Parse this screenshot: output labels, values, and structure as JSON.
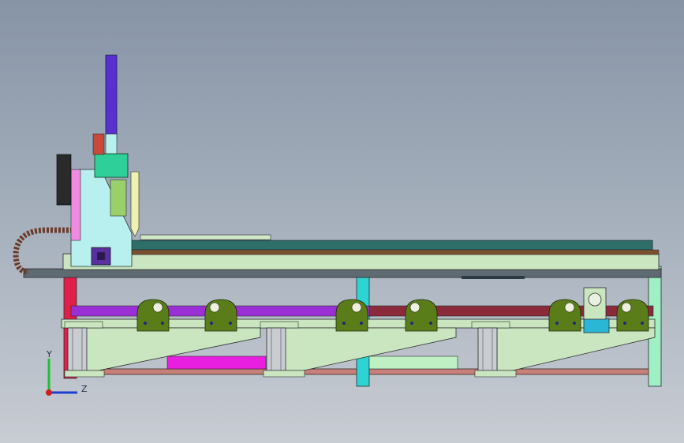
{
  "viewport": {
    "background_top": "#8794a6",
    "background_bottom": "#c8ccd3"
  },
  "triad": {
    "y_label": "Y",
    "z_label": "Z",
    "y_color": "#1fbf2f",
    "z_color": "#1d3fd1",
    "x_color": "#d11d1d"
  },
  "palette": {
    "frame": "#c9e6c0",
    "frame_stroke": "#2b2b2b",
    "gantry": "#b8f0f0",
    "mast": "#5a2fd0",
    "rail": "#2f6f6a",
    "saddle": "#5a7d1a",
    "purple_bar": "#9a2fd6",
    "maroon_bar": "#8a2a3a",
    "magenta_panel": "#e81ee0",
    "cyan_post": "#2ed3d3",
    "red_post": "#e0204a",
    "cylinder": "#c9ccd1",
    "motor_box": "#2ab7d6"
  }
}
